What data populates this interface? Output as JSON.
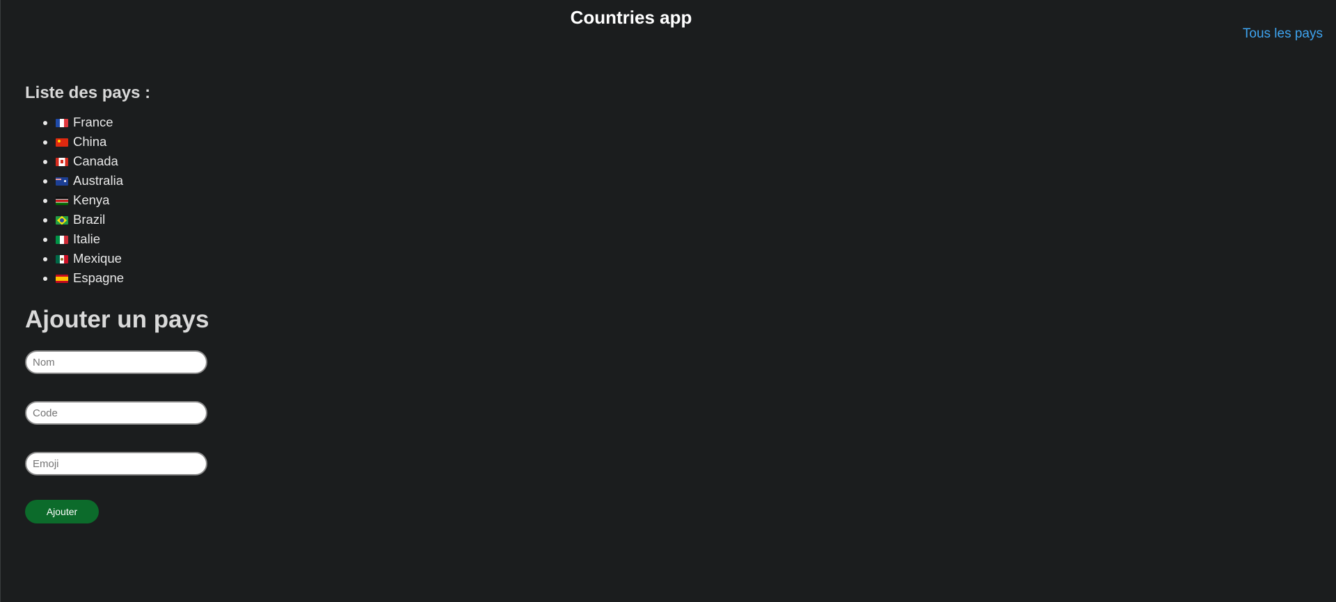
{
  "header": {
    "title": "Countries app",
    "nav_link": "Tous les pays"
  },
  "colors": {
    "background": "#1b1d1e",
    "link": "#3ea4f0",
    "button": "#0c6b2b"
  },
  "country_list": {
    "heading": "Liste des pays :",
    "items": [
      {
        "name": "France",
        "flag": "flag-france-icon"
      },
      {
        "name": "China",
        "flag": "flag-china-icon"
      },
      {
        "name": "Canada",
        "flag": "flag-canada-icon"
      },
      {
        "name": "Australia",
        "flag": "flag-australia-icon"
      },
      {
        "name": "Kenya",
        "flag": "flag-kenya-icon"
      },
      {
        "name": "Brazil",
        "flag": "flag-brazil-icon"
      },
      {
        "name": "Italie",
        "flag": "flag-italy-icon"
      },
      {
        "name": "Mexique",
        "flag": "flag-mexico-icon"
      },
      {
        "name": "Espagne",
        "flag": "flag-spain-icon"
      }
    ]
  },
  "form": {
    "heading": "Ajouter un pays",
    "name_placeholder": "Nom",
    "code_placeholder": "Code",
    "emoji_placeholder": "Emoji",
    "name_value": "",
    "code_value": "",
    "emoji_value": "",
    "submit_label": "Ajouter"
  }
}
